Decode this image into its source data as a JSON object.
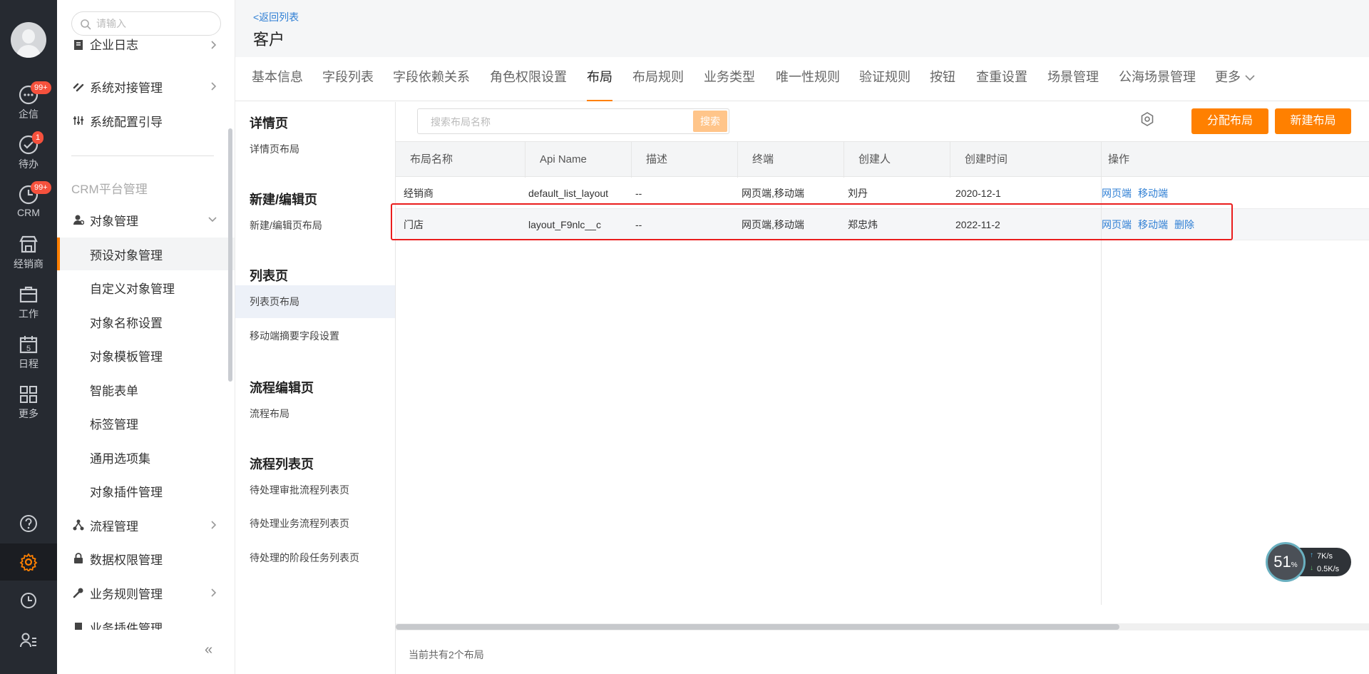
{
  "rail": {
    "items": [
      {
        "label": "企信",
        "badge": "99+"
      },
      {
        "label": "待办",
        "badge": "1"
      },
      {
        "label": "CRM",
        "badge": "99+"
      },
      {
        "label": "经销商"
      },
      {
        "label": "工作"
      },
      {
        "label": "日程",
        "day": "5"
      },
      {
        "label": "更多"
      }
    ]
  },
  "sidebar": {
    "search_placeholder": "请输入",
    "top_items": [
      {
        "label": "企业日志"
      },
      {
        "label": "系统对接管理"
      },
      {
        "label": "系统配置引导"
      }
    ],
    "group_title": "CRM平台管理",
    "object_mgmt": "对象管理",
    "sub_items": [
      {
        "label": "预设对象管理"
      },
      {
        "label": "自定义对象管理"
      },
      {
        "label": "对象名称设置"
      },
      {
        "label": "对象模板管理"
      },
      {
        "label": "智能表单"
      },
      {
        "label": "标签管理"
      },
      {
        "label": "通用选项集"
      },
      {
        "label": "对象插件管理"
      }
    ],
    "bottom_items": [
      {
        "label": "流程管理"
      },
      {
        "label": "数据权限管理"
      },
      {
        "label": "业务规则管理"
      },
      {
        "label": "业务插件管理"
      }
    ],
    "collapse": "«"
  },
  "header": {
    "back_label": "<返回列表",
    "title": "客户"
  },
  "tabs": [
    {
      "label": "基本信息"
    },
    {
      "label": "字段列表"
    },
    {
      "label": "字段依赖关系"
    },
    {
      "label": "角色权限设置"
    },
    {
      "label": "布局"
    },
    {
      "label": "布局规则"
    },
    {
      "label": "业务类型"
    },
    {
      "label": "唯一性规则"
    },
    {
      "label": "验证规则"
    },
    {
      "label": "按钮"
    },
    {
      "label": "查重设置"
    },
    {
      "label": "场景管理"
    },
    {
      "label": "公海场景管理"
    },
    {
      "label": "更多"
    }
  ],
  "page_types": {
    "sections": [
      {
        "title": "详情页",
        "items": [
          "详情页布局"
        ]
      },
      {
        "title": "新建/编辑页",
        "items": [
          "新建/编辑页布局"
        ]
      },
      {
        "title": "列表页",
        "items": [
          "列表页布局",
          "移动端摘要字段设置"
        ]
      },
      {
        "title": "流程编辑页",
        "items": [
          "流程布局"
        ]
      },
      {
        "title": "流程列表页",
        "items": [
          "待处理审批流程列表页",
          "待处理业务流程列表页",
          "待处理的阶段任务列表页"
        ]
      }
    ]
  },
  "toolbar": {
    "search_placeholder": "搜索布局名称",
    "search_button": "搜索",
    "assign_button": "分配布局",
    "new_button": "新建布局"
  },
  "table": {
    "columns": [
      "布局名称",
      "Api Name",
      "描述",
      "终端",
      "创建人",
      "创建时间",
      "操作"
    ],
    "rows": [
      {
        "name": "经销商",
        "api": "default_list_layout",
        "desc": "--",
        "terminal": "网页端,移动端",
        "creator": "刘丹",
        "created": "2020-12-1",
        "ops": [
          "网页端",
          "移动端"
        ]
      },
      {
        "name": "门店",
        "api": "layout_F9nlc__c",
        "desc": "--",
        "terminal": "网页端,移动端",
        "creator": "郑忠炜",
        "created": "2022-11-2",
        "ops": [
          "网页端",
          "移动端",
          "删除"
        ]
      }
    ],
    "footer": "当前共有2个布局"
  },
  "widget": {
    "percent": "51",
    "percent_unit": "%",
    "up_speed": "7K/s",
    "down_speed": "0.5K/s"
  },
  "colors": {
    "accent": "#ff8000",
    "link": "#2f7fd4",
    "rail_bg": "#262a31",
    "badge": "#f5513d",
    "highlight_box": "#ea1d1d"
  }
}
